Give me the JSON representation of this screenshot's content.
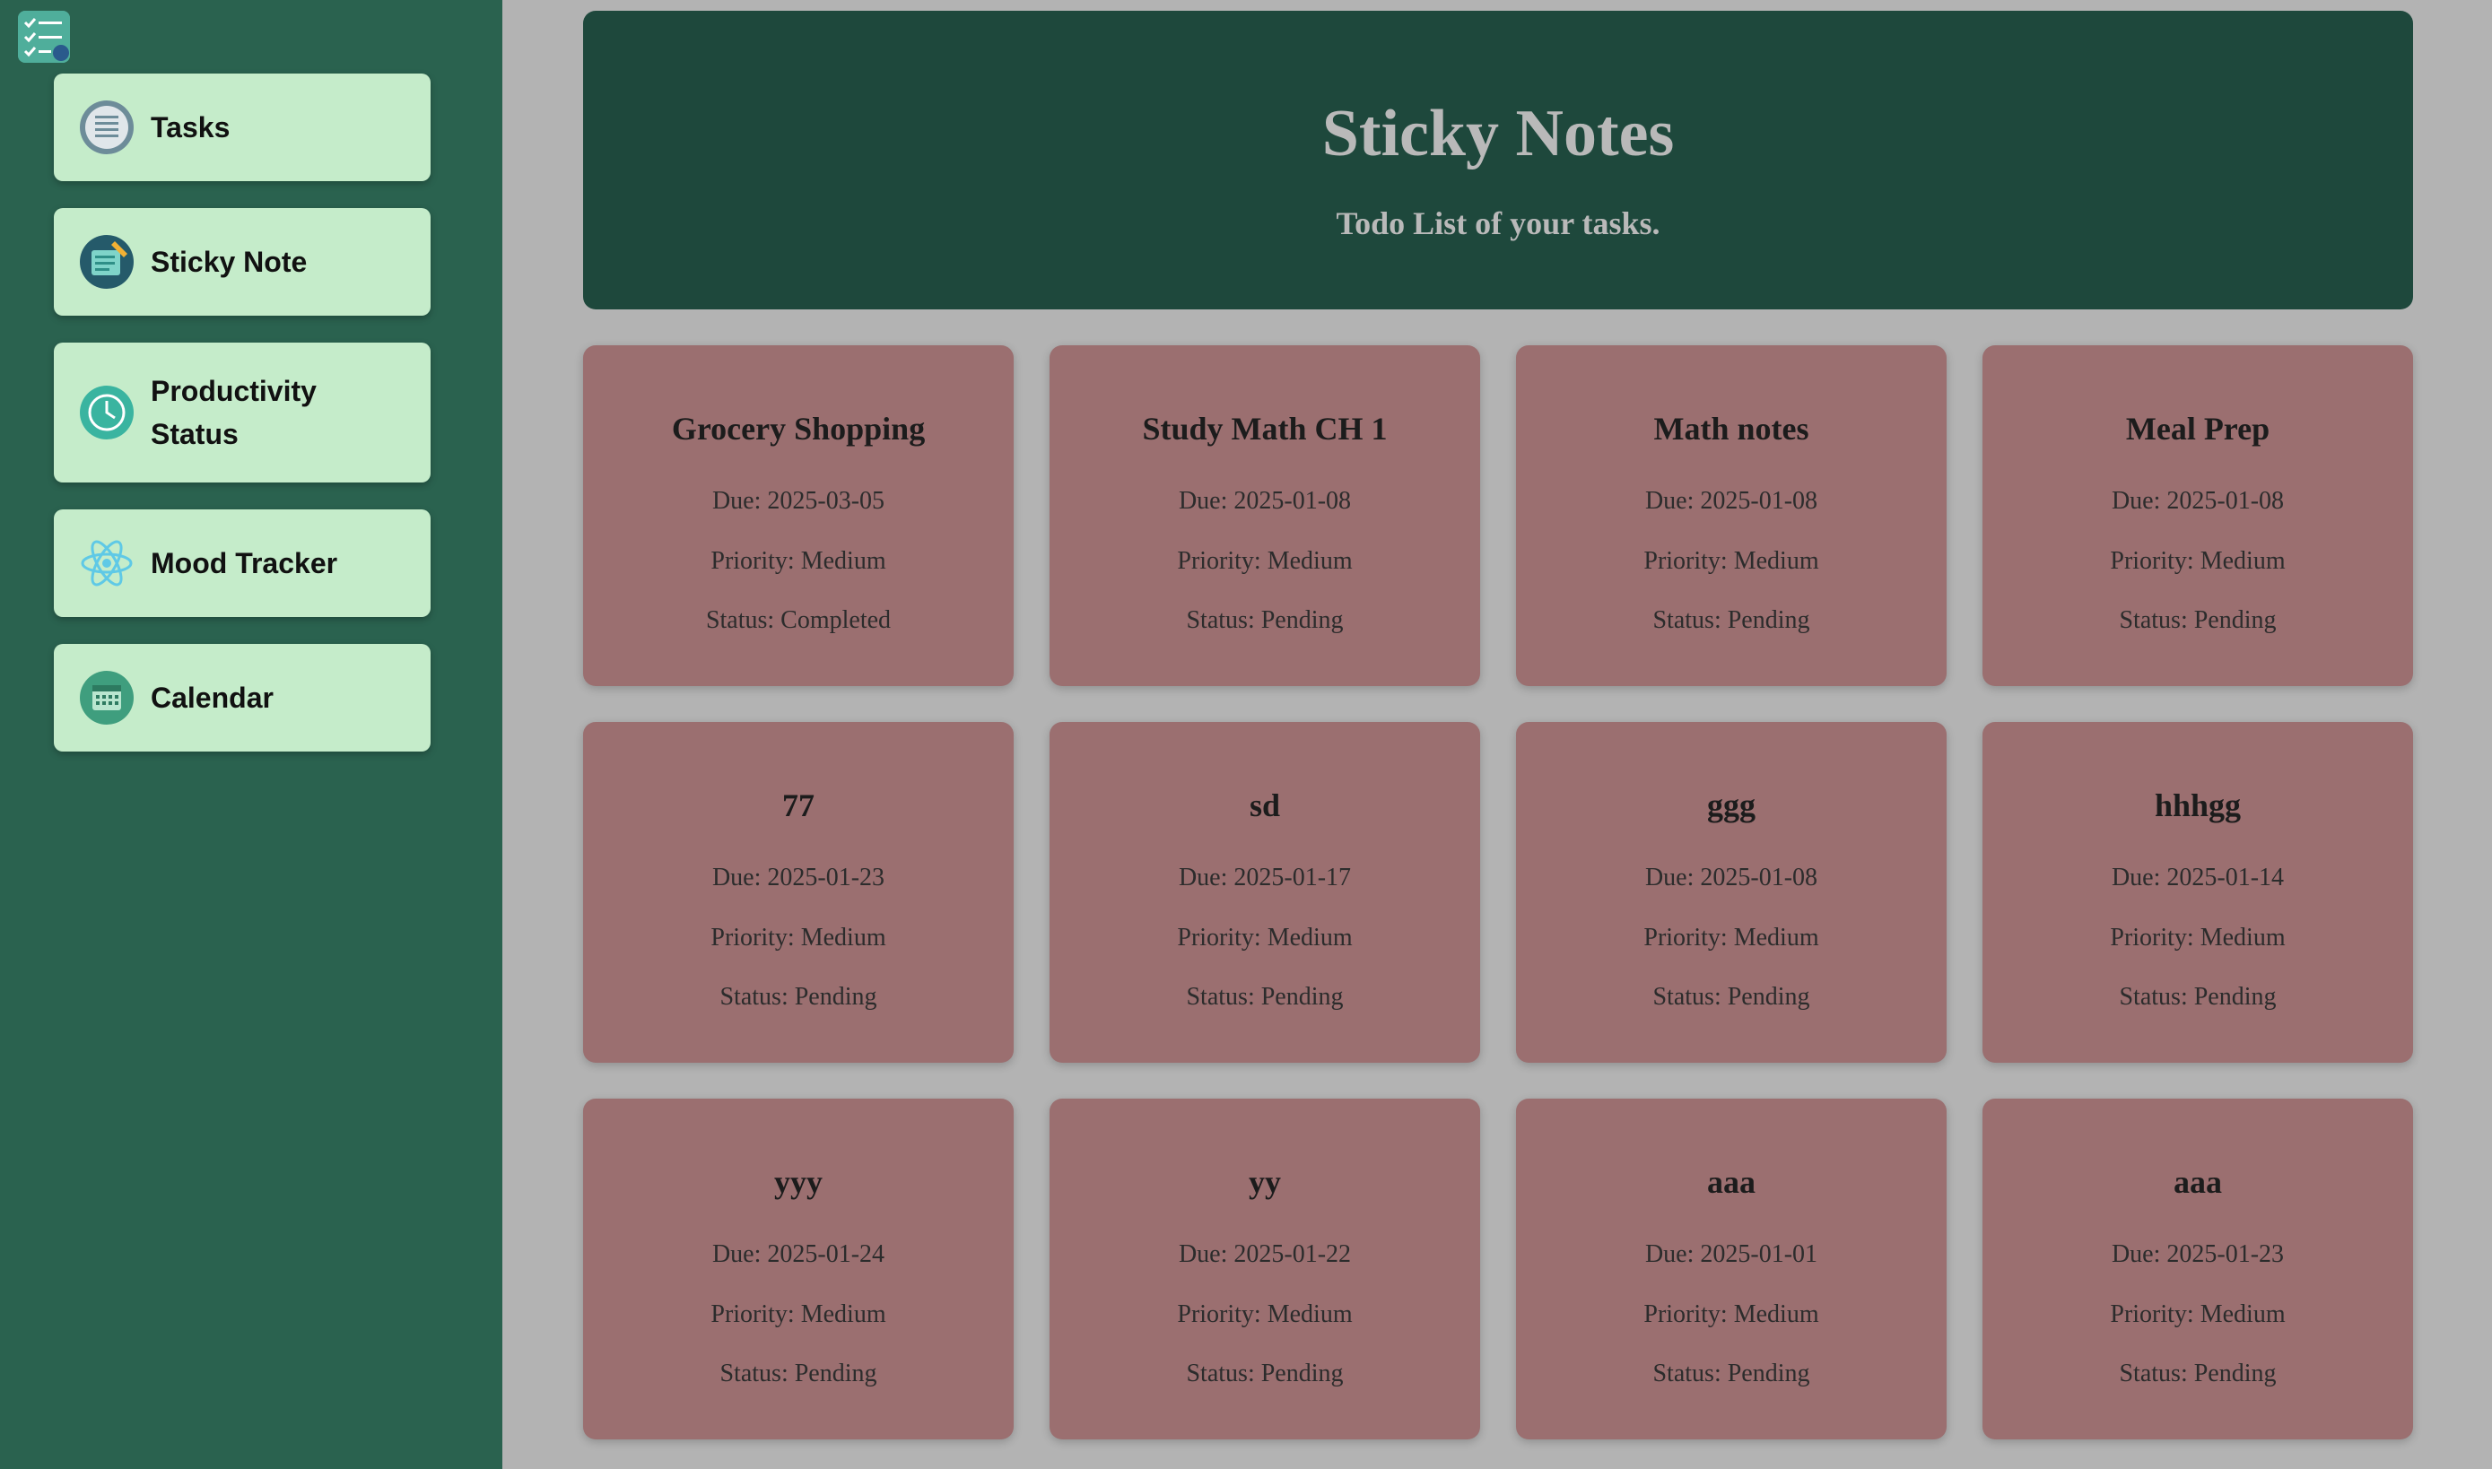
{
  "sidebar": {
    "items": [
      {
        "label": "Tasks",
        "icon": "list-icon"
      },
      {
        "label": "Sticky Note",
        "icon": "sticky-note-icon"
      },
      {
        "label": "Productivity Status",
        "icon": "clock-icon"
      },
      {
        "label": "Mood Tracker",
        "icon": "atom-icon"
      },
      {
        "label": "Calendar",
        "icon": "calendar-icon"
      }
    ]
  },
  "header": {
    "title": "Sticky Notes",
    "subtitle": "Todo List of your tasks."
  },
  "notes": [
    {
      "title": "Grocery Shopping",
      "due": "Due: 2025-03-05",
      "priority": "Priority: Medium",
      "status": "Status: Completed"
    },
    {
      "title": "Study Math CH 1",
      "due": "Due: 2025-01-08",
      "priority": "Priority: Medium",
      "status": "Status: Pending"
    },
    {
      "title": "Math notes",
      "due": "Due: 2025-01-08",
      "priority": "Priority: Medium",
      "status": "Status: Pending"
    },
    {
      "title": "Meal Prep",
      "due": "Due: 2025-01-08",
      "priority": "Priority: Medium",
      "status": "Status: Pending"
    },
    {
      "title": "77",
      "due": "Due: 2025-01-23",
      "priority": "Priority: Medium",
      "status": "Status: Pending"
    },
    {
      "title": "sd",
      "due": "Due: 2025-01-17",
      "priority": "Priority: Medium",
      "status": "Status: Pending"
    },
    {
      "title": "ggg",
      "due": "Due: 2025-01-08",
      "priority": "Priority: Medium",
      "status": "Status: Pending"
    },
    {
      "title": "hhhgg",
      "due": "Due: 2025-01-14",
      "priority": "Priority: Medium",
      "status": "Status: Pending"
    },
    {
      "title": "yyy",
      "due": "Due: 2025-01-24",
      "priority": "Priority: Medium",
      "status": "Status: Pending"
    },
    {
      "title": "yy",
      "due": "Due: 2025-01-22",
      "priority": "Priority: Medium",
      "status": "Status: Pending"
    },
    {
      "title": "aaa",
      "due": "Due: 2025-01-01",
      "priority": "Priority: Medium",
      "status": "Status: Pending"
    },
    {
      "title": "aaa",
      "due": "Due: 2025-01-23",
      "priority": "Priority: Medium",
      "status": "Status: Pending"
    }
  ],
  "colors": {
    "sidebar": "#2a624f",
    "nav_item": "#c5ecca",
    "header": "#1e483c",
    "note": "#9b6f70",
    "background": "#b3b3b3"
  }
}
